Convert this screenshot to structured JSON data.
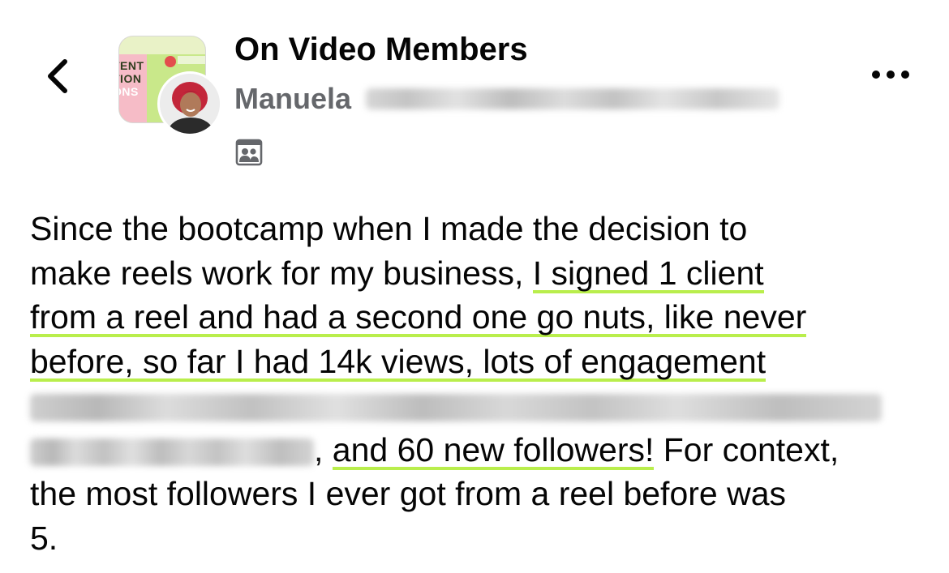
{
  "header": {
    "group_name": "On Video Members",
    "author_name": "Manuela",
    "group_thumbnail_text": [
      "TENT",
      "TION",
      "ONS"
    ],
    "icons": {
      "back": "chevron-left-icon",
      "more": "more-horizontal-icon",
      "privacy": "members-group-icon"
    }
  },
  "post": {
    "line1": "Since the bootcamp when I made the decision to",
    "line2_plain": "make reels work for my business, ",
    "line2_hl": "I signed 1 client",
    "line3_hl": "from a reel and had a second one go nuts, like never",
    "line4_hl": "before, so far I had 14k views, lots of engagement",
    "line6_sep": ", ",
    "line6_hl": "and 60 new followers!",
    "line6_tail": " For context,",
    "line7": "the most followers I ever got from a reel before was",
    "line8": "5."
  },
  "colors": {
    "highlight": "#b9ee4c",
    "secondary_text": "#65676b"
  }
}
